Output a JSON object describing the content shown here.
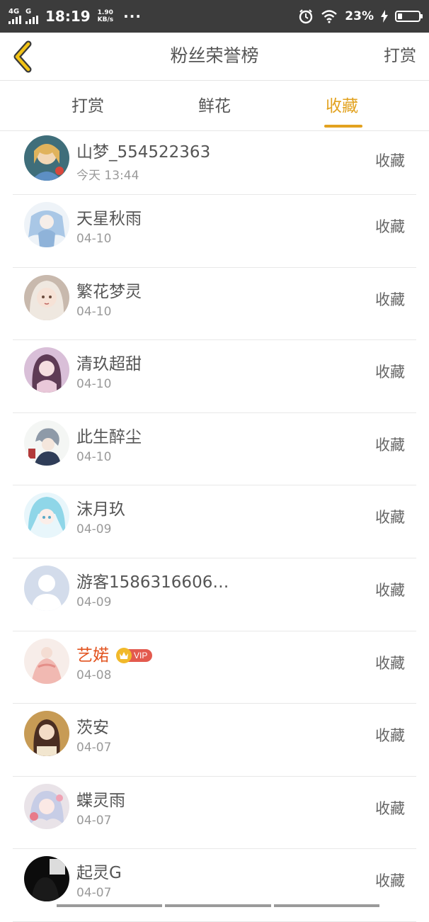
{
  "status_bar": {
    "network_1": "4G",
    "network_2": "G",
    "time": "18:19",
    "speed_value": "1.90",
    "speed_unit": "KB/s",
    "more": "···",
    "battery_percent": "23%",
    "battery_level": 0.23,
    "icons": [
      "signal-icon",
      "alarm-icon",
      "wifi-icon",
      "charging-icon",
      "battery-icon"
    ]
  },
  "header": {
    "title": "粉丝荣誉榜",
    "action_label": "打赏",
    "back_icon": "chevron-left-icon"
  },
  "tabs": [
    {
      "label": "打赏",
      "active": false
    },
    {
      "label": "鲜花",
      "active": false
    },
    {
      "label": "收藏",
      "active": true
    }
  ],
  "colors": {
    "accent": "#e2a21f",
    "vip_name": "#e2531f",
    "status_bar": "#3c3c3c",
    "text": "#555555",
    "subtext": "#9a9a9a"
  },
  "list": [
    {
      "name": "山梦_554522363",
      "date": "今天 13:44",
      "action": "收藏",
      "avatar": "avatar-icon"
    },
    {
      "name": "天星秋雨",
      "date": "04-10",
      "action": "收藏",
      "avatar": "avatar-icon"
    },
    {
      "name": "繁花梦灵",
      "date": "04-10",
      "action": "收藏",
      "avatar": "avatar-icon"
    },
    {
      "name": "清玖超甜",
      "date": "04-10",
      "action": "收藏",
      "avatar": "avatar-icon"
    },
    {
      "name": "此生醉尘",
      "date": "04-10",
      "action": "收藏",
      "avatar": "avatar-icon"
    },
    {
      "name": "沫月玖",
      "date": "04-09",
      "action": "收藏",
      "avatar": "avatar-icon"
    },
    {
      "name": "游客1586316606…",
      "date": "04-09",
      "action": "收藏",
      "avatar": "default-avatar-icon"
    },
    {
      "name": "艺婼",
      "date": "04-08",
      "action": "收藏",
      "avatar": "avatar-icon",
      "badge": "VIP"
    },
    {
      "name": "茨安",
      "date": "04-07",
      "action": "收藏",
      "avatar": "avatar-icon"
    },
    {
      "name": "蝶灵雨",
      "date": "04-07",
      "action": "收藏",
      "avatar": "avatar-icon"
    },
    {
      "name": "起灵G",
      "date": "04-07",
      "action": "收藏",
      "avatar": "avatar-icon"
    }
  ]
}
